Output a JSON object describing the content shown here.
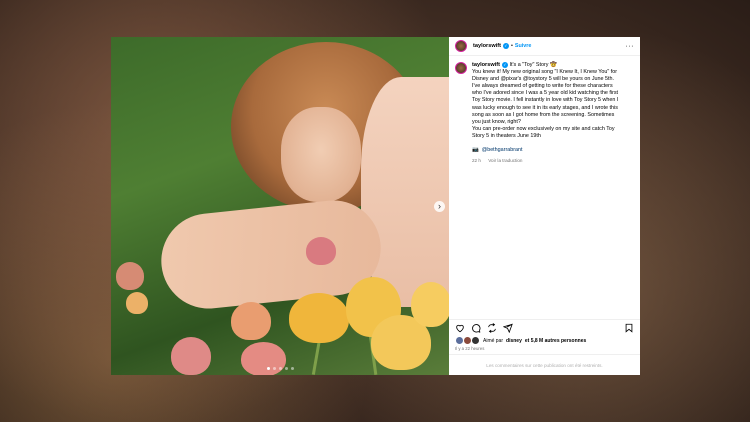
{
  "post": {
    "username": "taylorswift",
    "verified_icon": "verified-badge-icon",
    "separator": "•",
    "follow_label": "Suivre",
    "more_label": "···",
    "caption_lines": [
      "It's a \"Toy\" Story 🤠",
      "You knew it! My new original song \"I Knew It, I Knew You\" for",
      "Disney and @pixar's @toystory 5 will be yours on June 5th.",
      "I've always dreamed of getting to write for these characters",
      "who I've adored since I was a 5 year old kid watching the first",
      "Toy Story movie. I fell instantly in love with Toy Story 5 when I",
      "was lucky enough to see it in its early stages, and I wrote this",
      "song as soon as I got home from the screening. Sometimes",
      "you just know, right?",
      "You can pre-order now exclusively on my site and catch Toy",
      "Story 5 in theaters June 19th"
    ],
    "photo_credit_prefix": "📷",
    "photo_credit": "@bethgarrabrant",
    "time_ago": "22 h",
    "translate_label": "Voir la traduction",
    "liked_by_prefix": "Aimé par",
    "liked_by_user": "disney",
    "liked_by_suffix": "et 5,8 M autres personnes",
    "posted_ago": "Il y a 22 heures",
    "comments_closed": "Les commentaires sur cette publication ont été restreints."
  },
  "carousel": {
    "slide_count": 5,
    "active_index": 0,
    "next_label": "›"
  },
  "colors": {
    "accent": "#0095f6",
    "link": "#00376b",
    "muted": "#737373"
  }
}
